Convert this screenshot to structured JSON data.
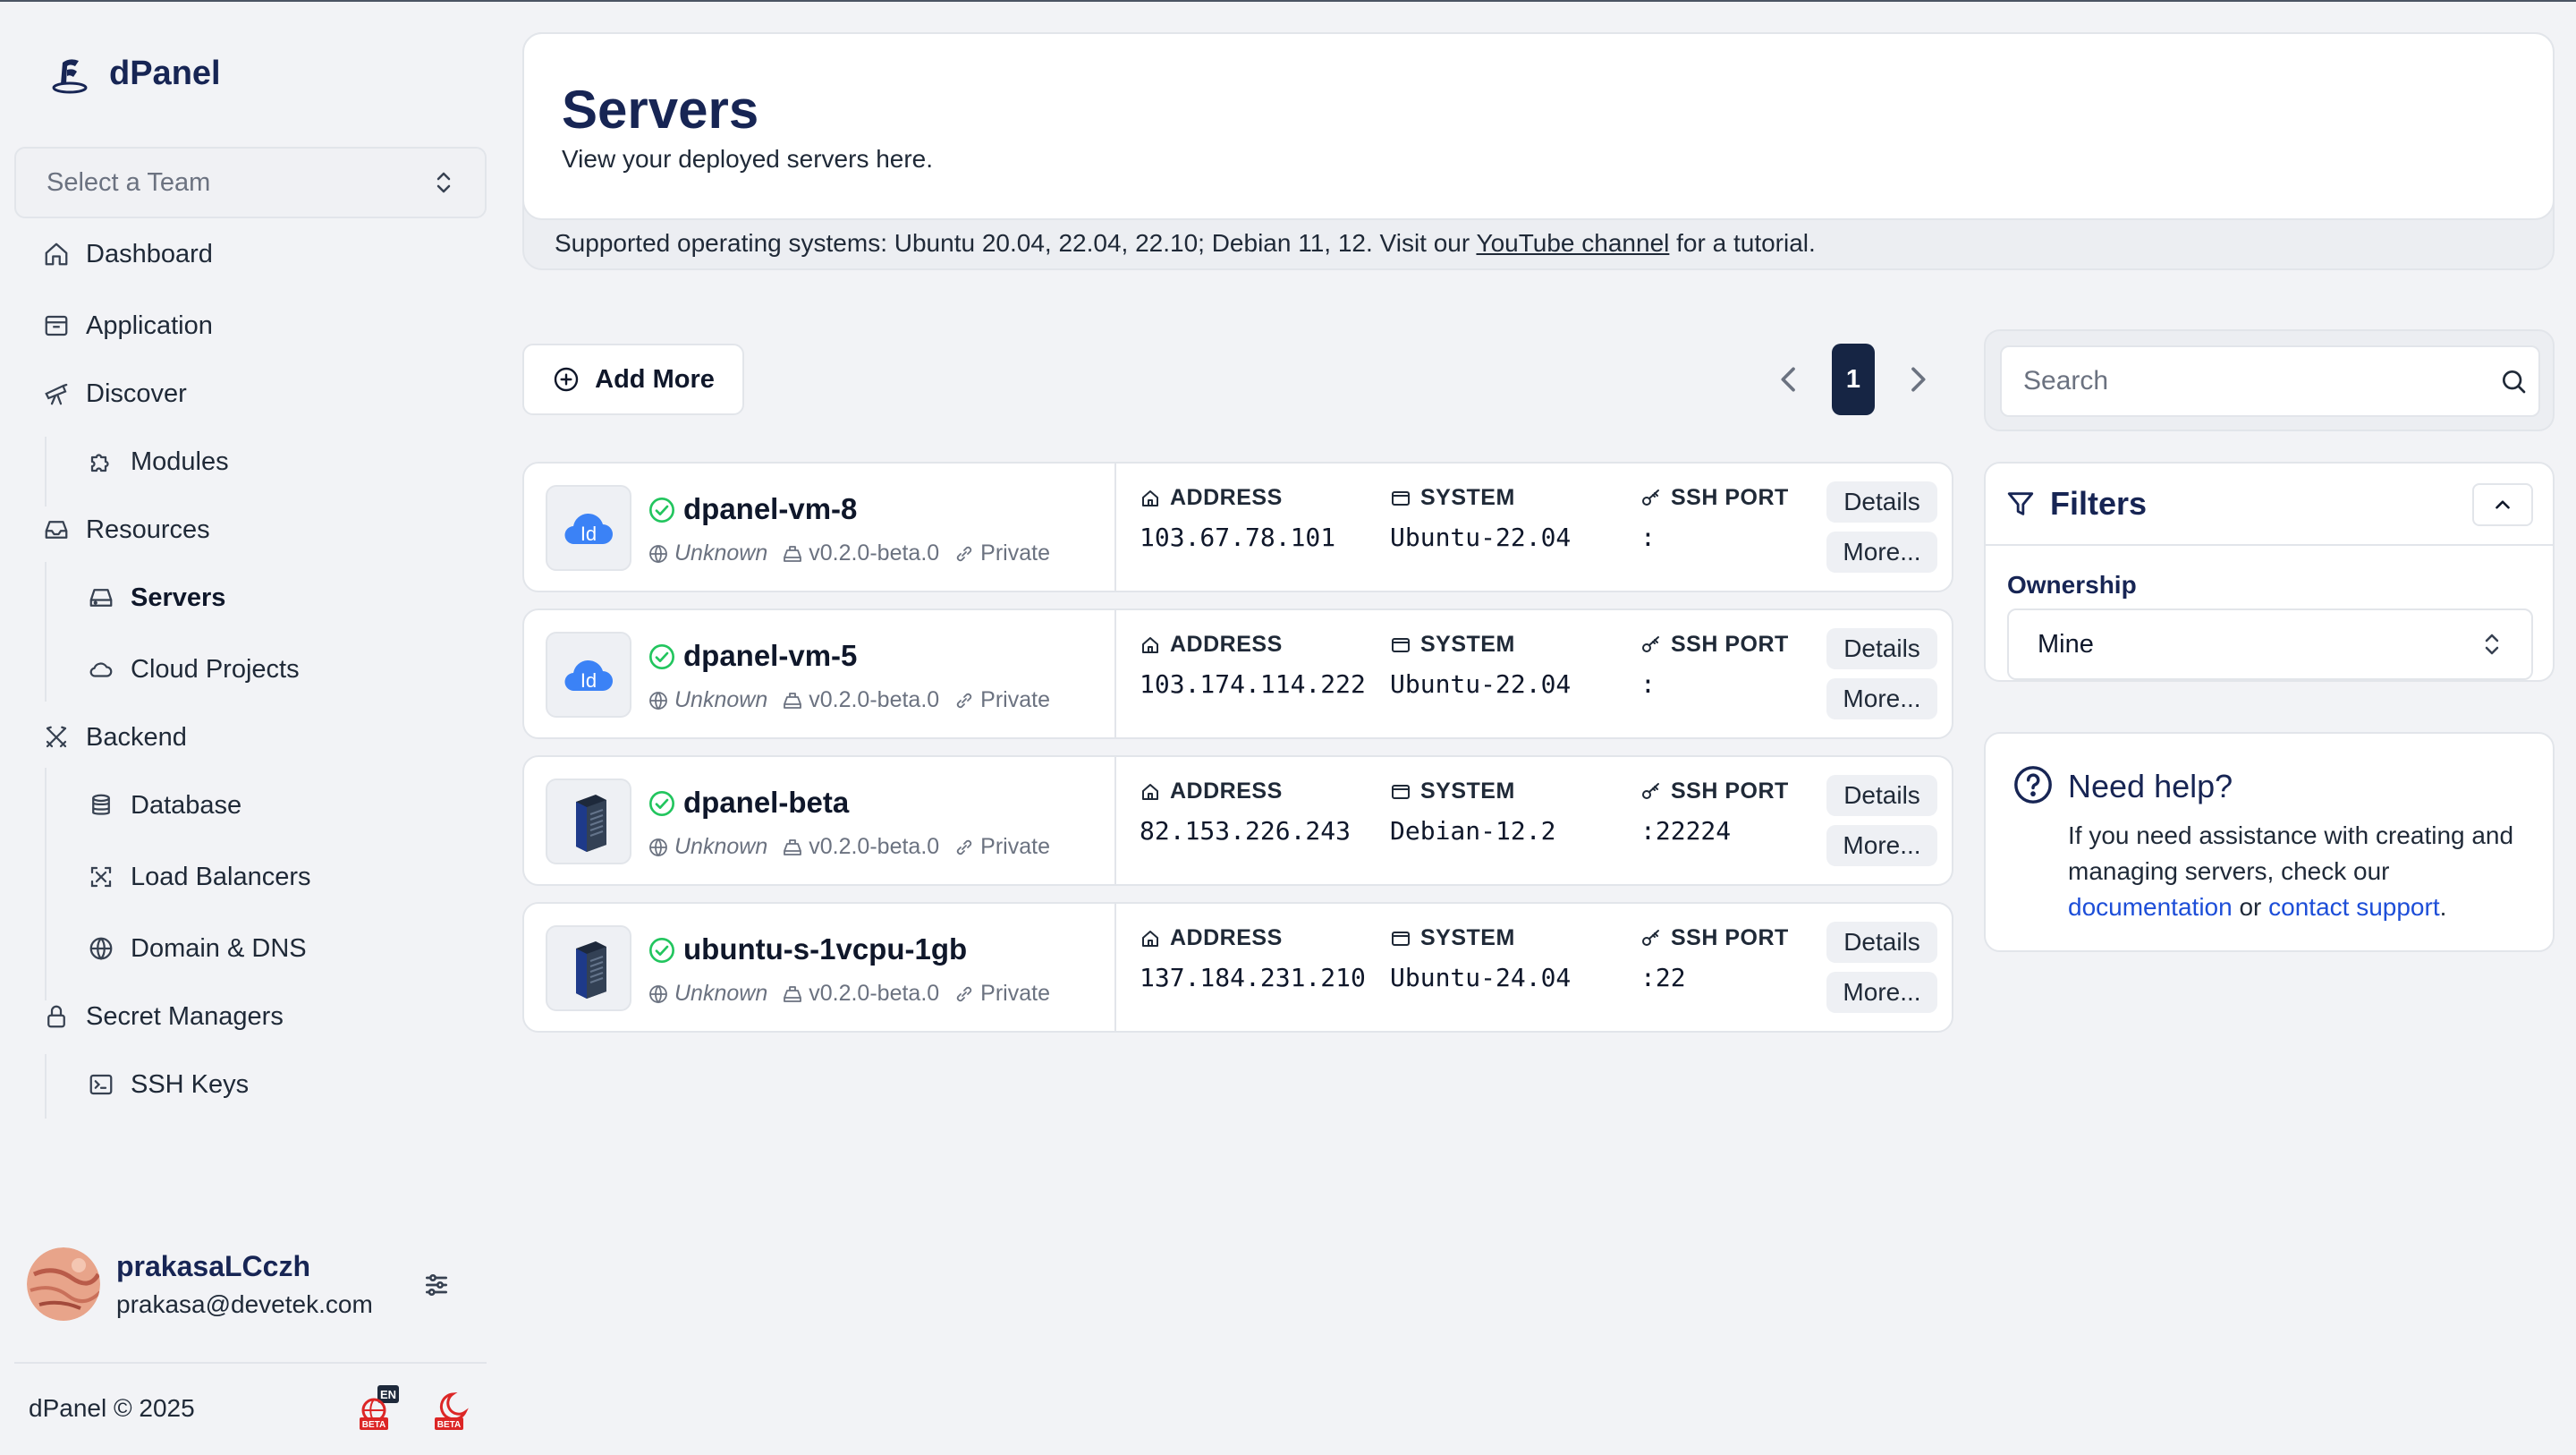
{
  "app": {
    "name": "dPanel"
  },
  "sidebar": {
    "team_select": {
      "placeholder": "Select a Team"
    },
    "items": [
      {
        "label": "Dashboard",
        "icon": "home-icon"
      },
      {
        "label": "Application",
        "icon": "archive-icon"
      },
      {
        "label": "Discover",
        "icon": "telescope-icon"
      },
      {
        "label": "Modules",
        "icon": "puzzle-icon"
      },
      {
        "label": "Resources",
        "icon": "inbox-icon"
      },
      {
        "label": "Servers",
        "icon": "hard-drive-icon",
        "active": true
      },
      {
        "label": "Cloud Projects",
        "icon": "cloud-icon"
      },
      {
        "label": "Backend",
        "icon": "tools-icon"
      },
      {
        "label": "Database",
        "icon": "database-icon"
      },
      {
        "label": "Load Balancers",
        "icon": "scan-icon"
      },
      {
        "label": "Domain & DNS",
        "icon": "globe-icon"
      },
      {
        "label": "Secret Managers",
        "icon": "lock-icon"
      },
      {
        "label": "SSH Keys",
        "icon": "terminal-icon"
      }
    ],
    "user": {
      "name": "prakasaLCczh",
      "email": "prakasa@devetek.com"
    },
    "footer": {
      "copyright": "dPanel © 2025",
      "lang_badge": "EN",
      "beta_badge": "BETA"
    }
  },
  "header": {
    "title": "Servers",
    "subtitle": "View your deployed servers here.",
    "support_prefix": "Supported operating systems: Ubuntu 20.04, 22.04, 22.10; Debian 11, 12. Visit our ",
    "support_link": "YouTube channel",
    "support_suffix": " for a tutorial."
  },
  "toolbar": {
    "add_more_label": "Add More",
    "current_page": "1"
  },
  "columns": {
    "address": "ADDRESS",
    "system": "SYSTEM",
    "ssh_port": "SSH PORT"
  },
  "row_actions": {
    "details": "Details",
    "more": "More..."
  },
  "servers": [
    {
      "name": "dpanel-vm-8",
      "icon": "cloud-id-icon",
      "location": "Unknown",
      "version": "v0.2.0-beta.0",
      "visibility": "Private",
      "address": "103.67.78.101",
      "system": "Ubuntu-22.04",
      "ssh_port": ":"
    },
    {
      "name": "dpanel-vm-5",
      "icon": "cloud-id-icon",
      "location": "Unknown",
      "version": "v0.2.0-beta.0",
      "visibility": "Private",
      "address": "103.174.114.222",
      "system": "Ubuntu-22.04",
      "ssh_port": ":"
    },
    {
      "name": "dpanel-beta",
      "icon": "server-tower-icon",
      "location": "Unknown",
      "version": "v0.2.0-beta.0",
      "visibility": "Private",
      "address": "82.153.226.243",
      "system": "Debian-12.2",
      "ssh_port": ":22224"
    },
    {
      "name": "ubuntu-s-1vcpu-1gb",
      "icon": "server-tower-icon",
      "location": "Unknown",
      "version": "v0.2.0-beta.0",
      "visibility": "Private",
      "address": "137.184.231.210",
      "system": "Ubuntu-24.04",
      "ssh_port": ":22"
    }
  ],
  "search": {
    "placeholder": "Search"
  },
  "filters": {
    "title": "Filters",
    "ownership_label": "Ownership",
    "ownership_value": "Mine"
  },
  "help": {
    "title": "Need help?",
    "text_prefix": "If you need assistance with creating and managing servers, check our ",
    "documentation_link": "documentation",
    "text_middle": " or ",
    "support_link": "contact support",
    "text_suffix": "."
  },
  "colors": {
    "brand_navy": "#172554",
    "page_bg": "#f2f3f6",
    "status_green": "#22c55e",
    "link_blue": "#1d4ed8",
    "cloud_blue": "#3b82f6"
  }
}
